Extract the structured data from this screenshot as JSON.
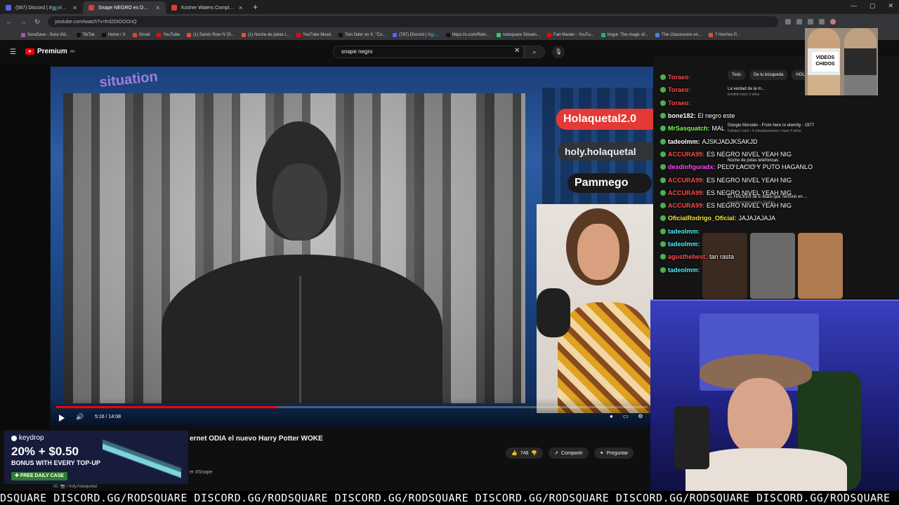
{
  "browser": {
    "tabs": [
      {
        "label": "(587) Discord | #📺vídeos-d..."
      },
      {
        "label": "Snape NEGRO es DESTRUIDO p..."
      },
      {
        "label": "Kosher Waters Completo - You..."
      }
    ],
    "url": "youtube.com/watch?v=frd2DtOOOnQ",
    "bookmarks": [
      "SoraSave - Sora Vid...",
      "TikTok",
      "Home / X",
      "Gmail",
      "YouTube",
      "(1) Saints Row IV [S...",
      "(1) Noche de jodas t...",
      "YouTube Music",
      "Tom Dder on X: \"Co...",
      "(787) Discord | #📺...",
      "https://x.com/Rain...",
      "rodsquare Stream...",
      "Fart Master - YouTu...",
      "Imgur: The magic of...",
      "The Classrooms en...",
      "7 Hechos P..."
    ]
  },
  "youtube": {
    "logo_text": "Premium",
    "logo_region": "AR",
    "search_value": "snape negro",
    "player": {
      "time": "5:16 / 14:08",
      "progress_fraction": 0.373,
      "overlay_names": [
        "Holaquetal2.0",
        "holy.holaquetal",
        "Pammego"
      ],
      "neon_text": "situation"
    },
    "video_title": "ernet ODIA el nuevo Harry Potter WOKE",
    "likes": "748",
    "share_label": "Compartir",
    "ask_label": "Preguntar",
    "hashtag": "er #Snape",
    "ig_line": "IG: 📷 / holy.holaquetal",
    "chips": [
      "Todo",
      "De tu búsqueda",
      "HOLA QUE T..."
    ],
    "recommendations": [
      {
        "title": "La verdad de la m...",
        "meta": "Emitido hace 3 años"
      },
      {
        "title": "Giorgio Moroder - From here to eternity - 1977",
        "meta": "Fabiano Lüch • 4 visualizaciones • hace 4 años"
      },
      {
        "title": "Noche de jodas telefónicas",
        "meta": "Emitido hace 2 años"
      },
      {
        "title": "EL HACKER de E-Mails que Terminó en ...",
        "meta": "visualizaciones • hace 10 días"
      }
    ]
  },
  "chat": [
    {
      "user": "Toraeo:",
      "msg": "",
      "color": "#ff4d4d"
    },
    {
      "user": "Toraeo:",
      "msg": "",
      "color": "#ff4d4d"
    },
    {
      "user": "Toraeo:",
      "msg": "",
      "color": "#ff4d4d"
    },
    {
      "user": "bone182:",
      "msg": "El negro este",
      "color": "#ffffff"
    },
    {
      "user": "MrSasquatch:",
      "msg": "MAL",
      "color": "#7cff4d"
    },
    {
      "user": "tadeolmm:",
      "msg": "AJSKJADJKSAKJD",
      "color": "#ffffff"
    },
    {
      "user": "ACCURA99:",
      "msg": "ES NEGRO NIVEL YEAH NIG",
      "color": "#ff4d4d"
    },
    {
      "user": "desdinfiguradx:",
      "msg": "PELO LACIO Y PUTO HAGANLO",
      "color": "#ff4dff"
    },
    {
      "user": "ACCURA99:",
      "msg": "ES NEGRO NIVEL YEAH NIG",
      "color": "#ff4d4d"
    },
    {
      "user": "ACCURA99:",
      "msg": "ES NEGRO NIVEL YEAH NIG",
      "color": "#ff4d4d"
    },
    {
      "user": "ACCURA99:",
      "msg": "ES NEGRO NIVEL YEAH NIG",
      "color": "#ff4d4d"
    },
    {
      "user": "OficialRodrigo_Oficial:",
      "msg": "JAJAJAJAJA",
      "color": "#f5e642"
    },
    {
      "user": "tadeolmm:",
      "msg": "",
      "color": "#4df0ff"
    },
    {
      "user": "tadeolmm:",
      "msg": "",
      "color": "#4df0ff"
    },
    {
      "user": "agusthebest:",
      "msg": "tan rasta",
      "color": "#ff4d4d"
    },
    {
      "user": "tadeolmm:",
      "msg": "",
      "color": "#4df0ff"
    }
  ],
  "promo": {
    "label": "VIDEOS CHIDOS"
  },
  "ad": {
    "brand": "keydrop",
    "headline": "20% + $0.50",
    "bonus": "BONUS WITH EVERY TOP-UP",
    "cta": "FREE DAILY CASE"
  },
  "marquee": "DSQUARE  DISCORD.GG/RODSQUARE  DISCORD.GG/RODSQUARE  DISCORD.GG/RODSQUARE  DISCORD.GG/RODSQUARE  DISCORD.GG/RODSQUARE  DISCORD.GG/RODSQUARE"
}
